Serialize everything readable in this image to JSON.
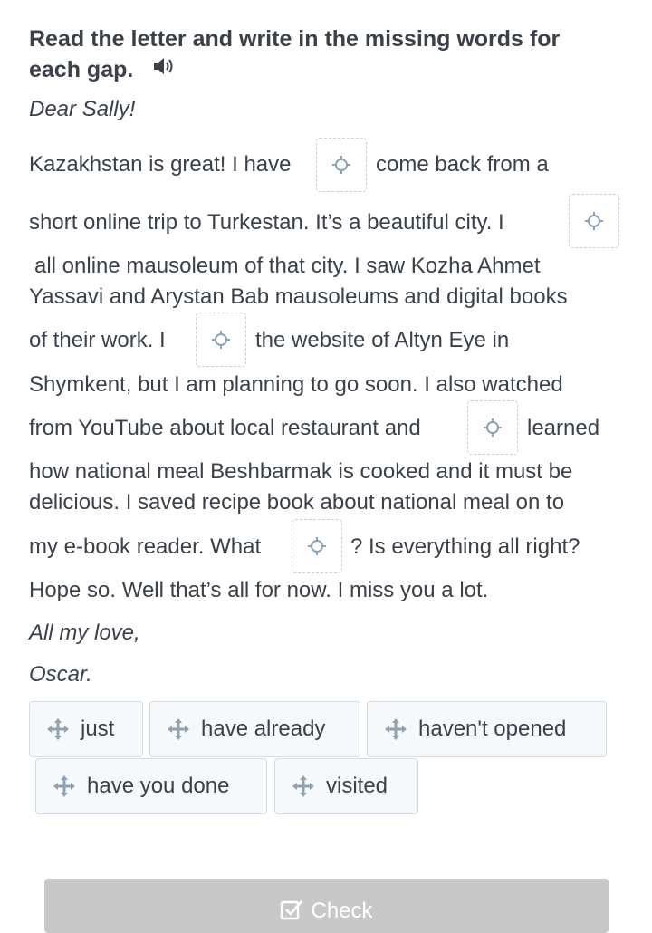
{
  "instruction": {
    "line1": "Read the letter and write in the missing words for",
    "line2": "each gap."
  },
  "letter": {
    "greeting": "Dear Sally!",
    "line1_a": "Kazakhstan is great! I have",
    "line1_b": "come back from a",
    "line2": "short online trip to Turkestan. It’s a beautiful city. I",
    "line3": "all online mausoleum of that city. I saw Kozha Ahmet",
    "line4": "Yassavi and Arystan Bab mausoleums and digital books",
    "line5_a": "of their work. I",
    "line5_b": "the website of Altyn Eye in",
    "line6": "Shymkent, but I am planning to go soon. I also watched",
    "line7_a": "from YouTube about local restaurant and",
    "line7_b": "learned",
    "line8": "how national meal Beshbarmak is cooked and it must be",
    "line9": "delicious. I saved recipe book about national meal on to",
    "line10_a": "my e-book reader. What",
    "line10_b": "? Is everything all right?",
    "line11": "Hope so. Well that’s all for now. I miss you a lot.",
    "closing": "All my love,",
    "signature": "Oscar."
  },
  "word_bank": [
    "just",
    "have already",
    "haven't opened",
    "have you done",
    "visited"
  ],
  "check_button": {
    "label": "Check"
  },
  "icons": {
    "speaker": "speaker-icon",
    "move": "move-icon",
    "check": "check-icon"
  },
  "colors": {
    "text": "#3b4148",
    "chip_bg": "#f5f9fc",
    "check_bg": "#c8c8c8"
  }
}
